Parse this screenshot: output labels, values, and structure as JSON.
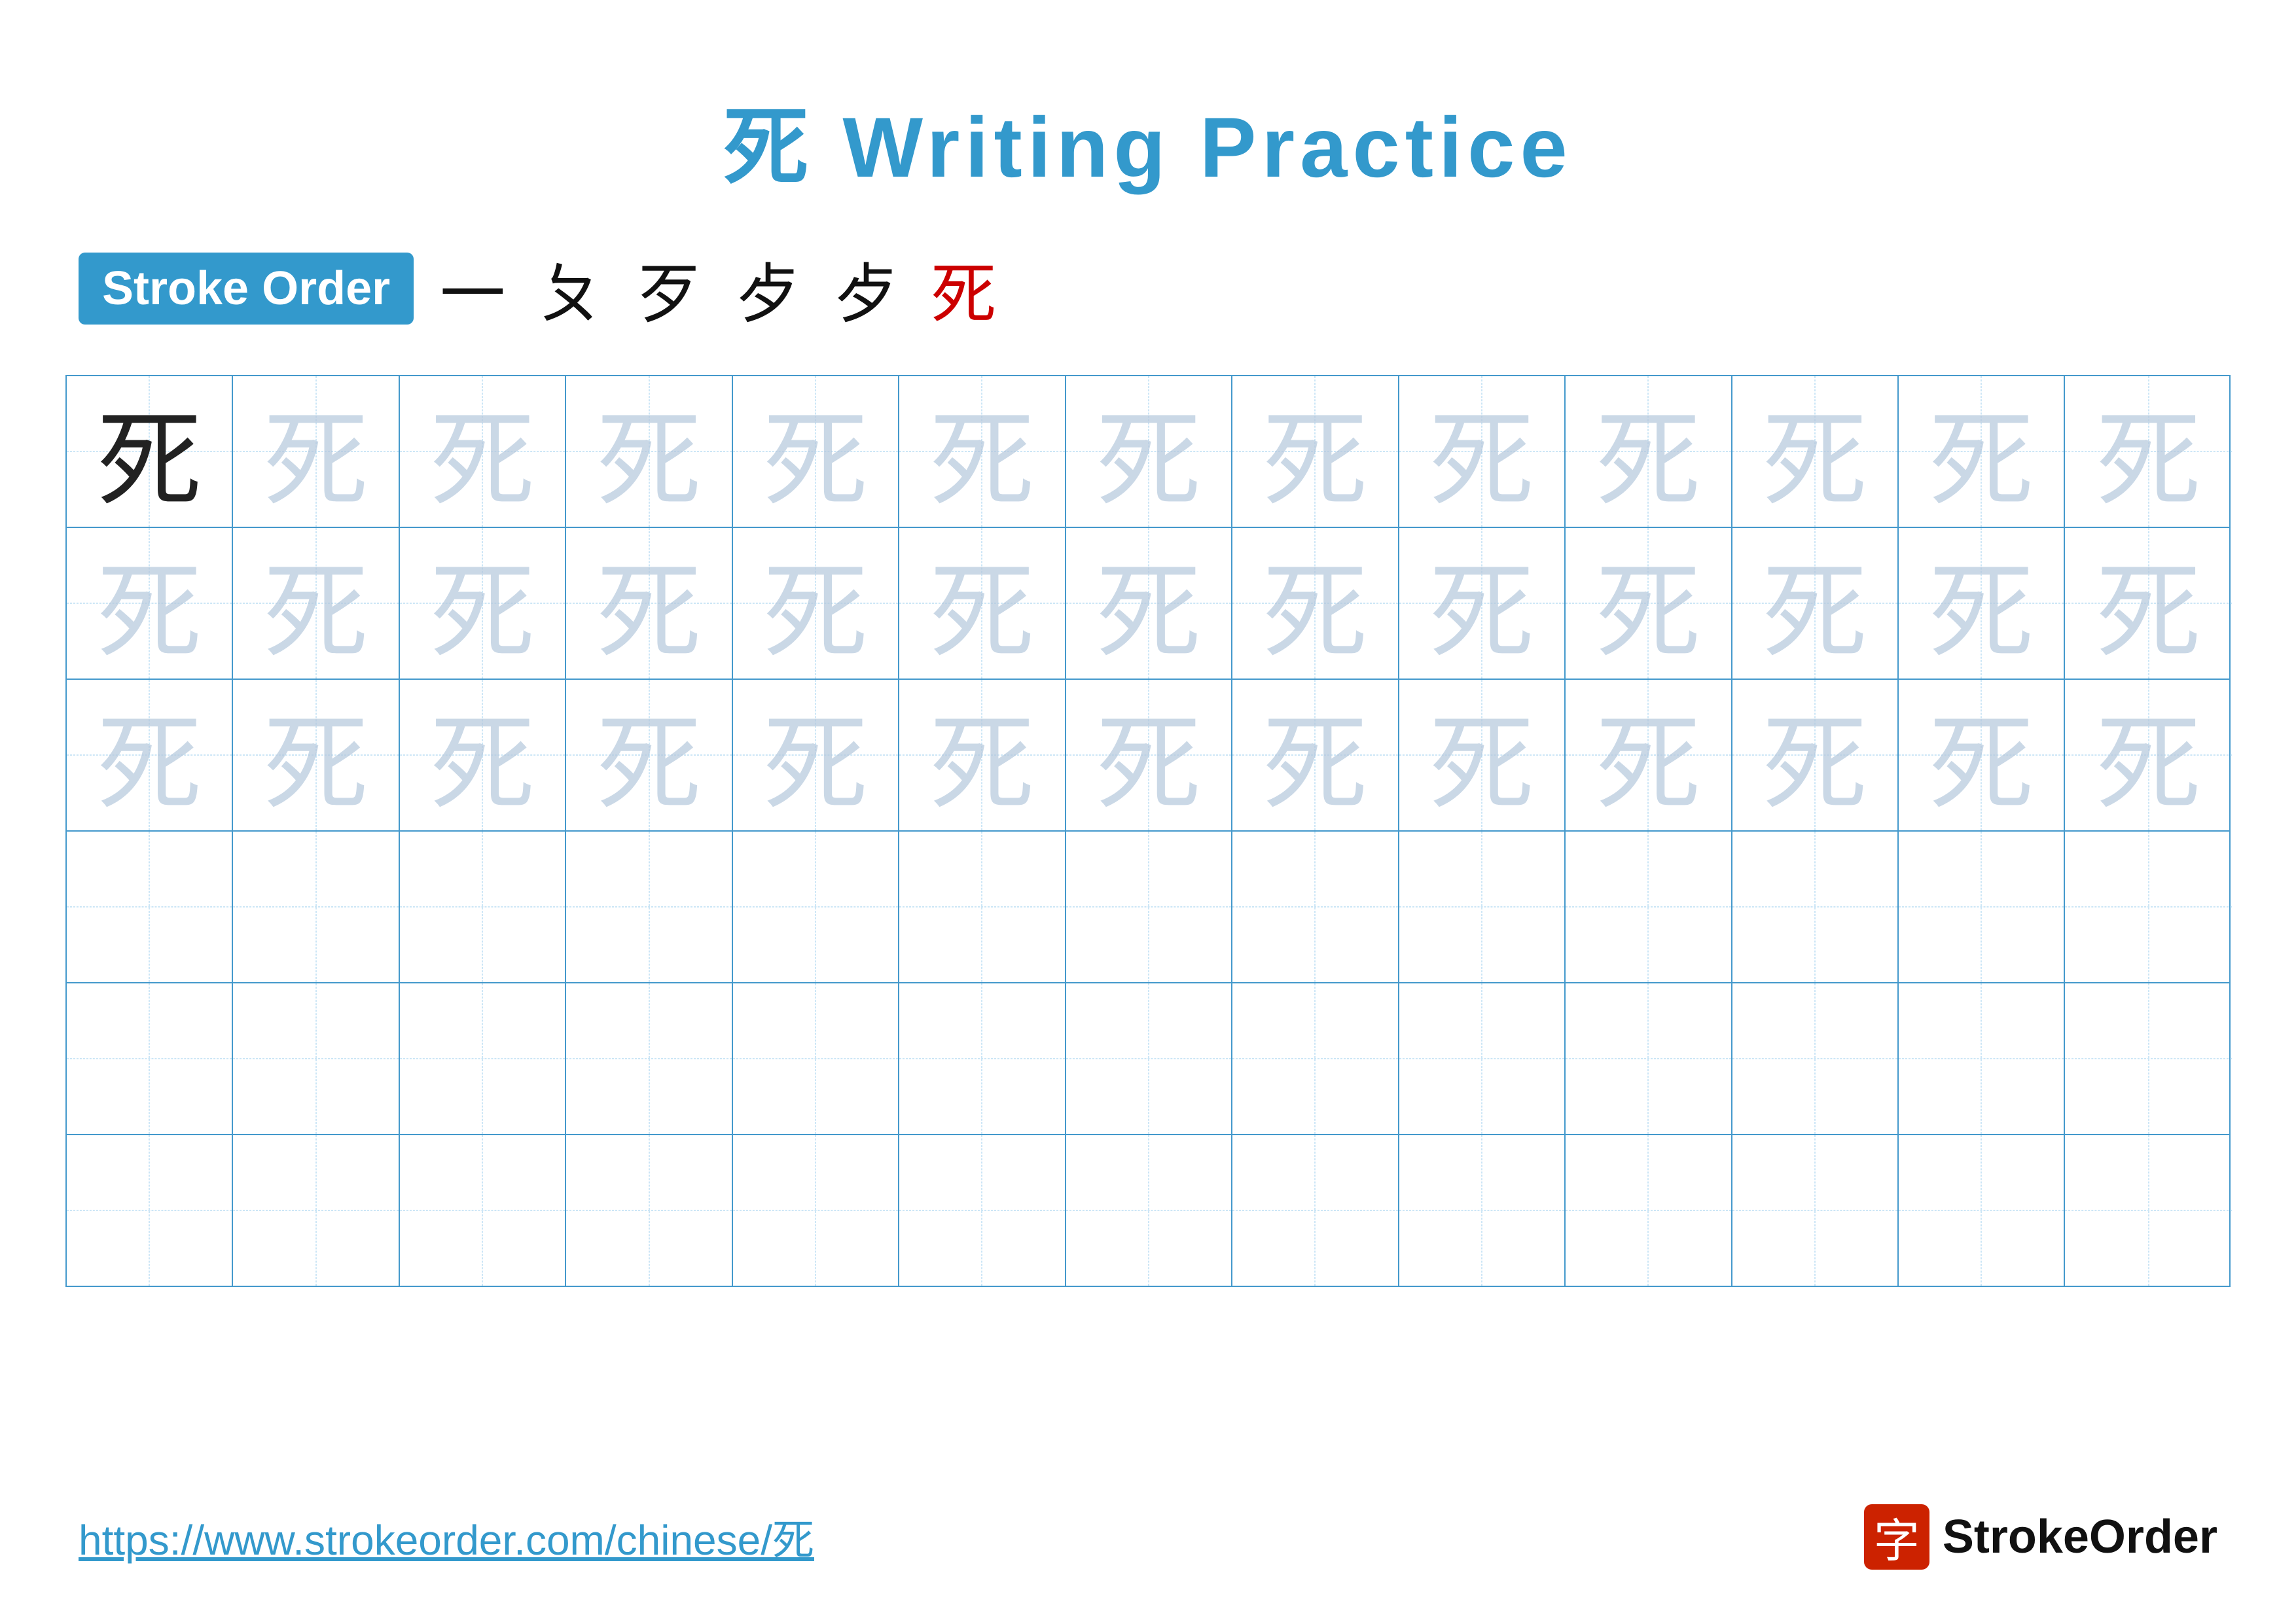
{
  "page": {
    "title": "死 Writing Practice",
    "title_char": "死",
    "title_suffix": " Writing Practice"
  },
  "stroke_order": {
    "badge_label": "Stroke Order",
    "strokes": [
      "一",
      "ㄆ",
      "歹",
      "歺",
      "歺",
      "死"
    ]
  },
  "grid": {
    "rows": 6,
    "cols": 13,
    "chars": {
      "row0": [
        "dark",
        "light",
        "light",
        "light",
        "light",
        "light",
        "light",
        "light",
        "light",
        "light",
        "light",
        "light",
        "light"
      ],
      "row1": [
        "light",
        "light",
        "light",
        "light",
        "light",
        "light",
        "light",
        "light",
        "light",
        "light",
        "light",
        "light",
        "light"
      ],
      "row2": [
        "light",
        "light",
        "light",
        "light",
        "light",
        "light",
        "light",
        "light",
        "light",
        "light",
        "light",
        "light",
        "light"
      ],
      "row3": [
        "empty",
        "empty",
        "empty",
        "empty",
        "empty",
        "empty",
        "empty",
        "empty",
        "empty",
        "empty",
        "empty",
        "empty",
        "empty"
      ],
      "row4": [
        "empty",
        "empty",
        "empty",
        "empty",
        "empty",
        "empty",
        "empty",
        "empty",
        "empty",
        "empty",
        "empty",
        "empty",
        "empty"
      ],
      "row5": [
        "empty",
        "empty",
        "empty",
        "empty",
        "empty",
        "empty",
        "empty",
        "empty",
        "empty",
        "empty",
        "empty",
        "empty",
        "empty"
      ]
    }
  },
  "footer": {
    "url": "https://www.strokeorder.com/chinese/死",
    "logo_char": "字",
    "logo_text": "StrokeOrder"
  }
}
